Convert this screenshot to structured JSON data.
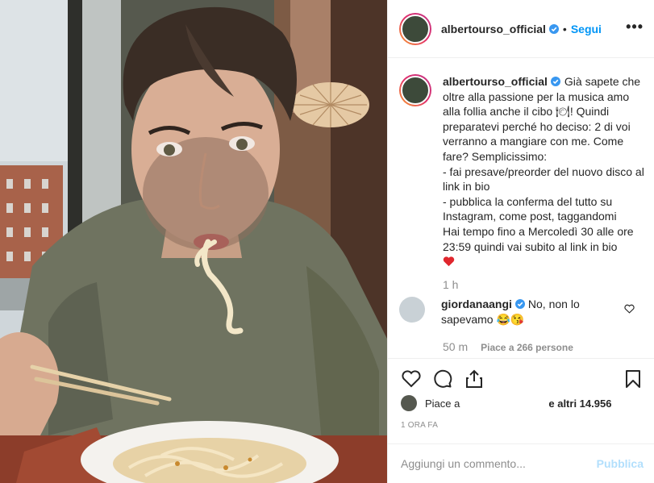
{
  "header": {
    "username": "albertourso_official",
    "separator": "•",
    "follow_label": "Segui",
    "more_label": "•••"
  },
  "caption": {
    "username": "albertourso_official",
    "text": "Già sapete che oltre alla passione per la musica amo alla follia anche il cibo 🍽! Quindi preparatevi perché ho deciso: 2 di voi verranno a mangiare con me. Come fare? Semplicissimo:\n- fai presave/preorder del nuovo disco al link in bio\n- pubblica la conferma del tutto su Instagram, come post, taggandomi\nHai tempo fino a Mercoledì 30 alle ore 23:59 quindi vai subito al link in bio",
    "time": "1 h"
  },
  "comment": {
    "username": "giordanaangi",
    "text": "No, non lo sapevamo 😂😘",
    "time": "50 m",
    "likes": "Piace a 266 persone"
  },
  "likes": {
    "prefix": "Piace a",
    "suffix": "e altri 14.956"
  },
  "date": "1 ORA FA",
  "composer": {
    "placeholder": "Aggiungi un commento...",
    "publish_label": "Pubblica"
  },
  "colors": {
    "link": "#0095f6",
    "muted": "#8e8e8e",
    "text": "#262626",
    "verified": "#3897f0",
    "publish_disabled": "#b2dffc"
  },
  "icons": [
    "verified-badge-icon",
    "more-options-icon",
    "heart-icon",
    "comment-icon",
    "share-icon",
    "bookmark-icon",
    "comment-heart-icon",
    "red-heart-emoji"
  ]
}
